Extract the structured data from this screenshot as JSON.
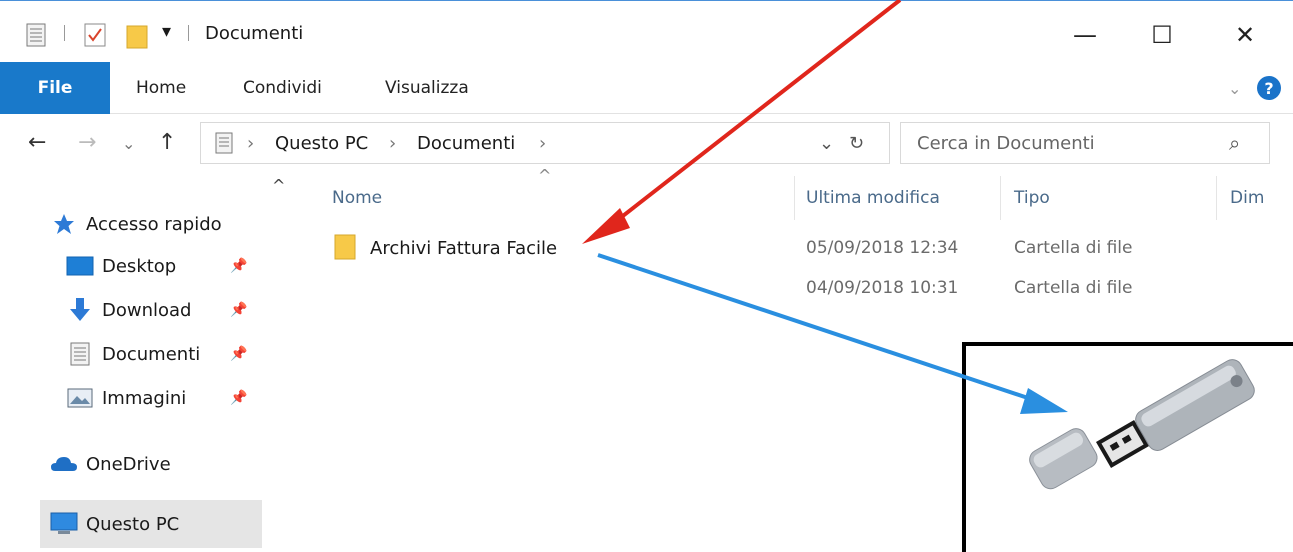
{
  "window": {
    "title": "Documenti",
    "minimize_glyph": "—",
    "maximize_glyph": "☐",
    "close_glyph": "✕",
    "qat_dropdown_glyph": "▾"
  },
  "ribbon": {
    "tabs": [
      "File",
      "Home",
      "Condividi",
      "Visualizza"
    ],
    "expand_glyph": "⌄",
    "help_glyph": "?"
  },
  "address_bar": {
    "back_glyph": "←",
    "forward_glyph": "→",
    "recent_glyph": "⌄",
    "up_glyph": "↑",
    "separator_glyph": "›",
    "path": [
      "Questo PC",
      "Documenti"
    ],
    "dropdown_glyph": "⌄",
    "refresh_glyph": "↻",
    "search_placeholder": "Cerca in Documenti",
    "search_glyph": "⌕"
  },
  "sidebar": {
    "scroll_up_glyph": "^",
    "pin_glyph": "📌",
    "items": [
      {
        "label": "Accesso rapido",
        "icon": "star-icon",
        "pinned": false
      },
      {
        "label": "Desktop",
        "icon": "desktop-icon",
        "pinned": true
      },
      {
        "label": "Download",
        "icon": "download-icon",
        "pinned": true
      },
      {
        "label": "Documenti",
        "icon": "document-icon",
        "pinned": true
      },
      {
        "label": "Immagini",
        "icon": "image-icon",
        "pinned": true
      },
      {
        "label": "OneDrive",
        "icon": "cloud-icon",
        "pinned": false
      },
      {
        "label": "Questo PC",
        "icon": "computer-icon",
        "pinned": false,
        "selected": true
      }
    ]
  },
  "file_list": {
    "sort_glyph": "^",
    "columns": [
      "Nome",
      "Ultima modifica",
      "Tipo",
      "Dim"
    ],
    "rows": [
      {
        "name": "Archivi Fattura Facile",
        "modified": "05/09/2018 12:34",
        "type": "Cartella di file"
      },
      {
        "name": "",
        "modified": "04/09/2018 10:31",
        "type": "Cartella di file"
      }
    ]
  },
  "colors": {
    "file_tab": "#1979ca",
    "red_arrow": "#e0261c",
    "blue_arrow": "#2a8fe0",
    "selection": "#e5e5e5",
    "help": "#1a73c9"
  }
}
